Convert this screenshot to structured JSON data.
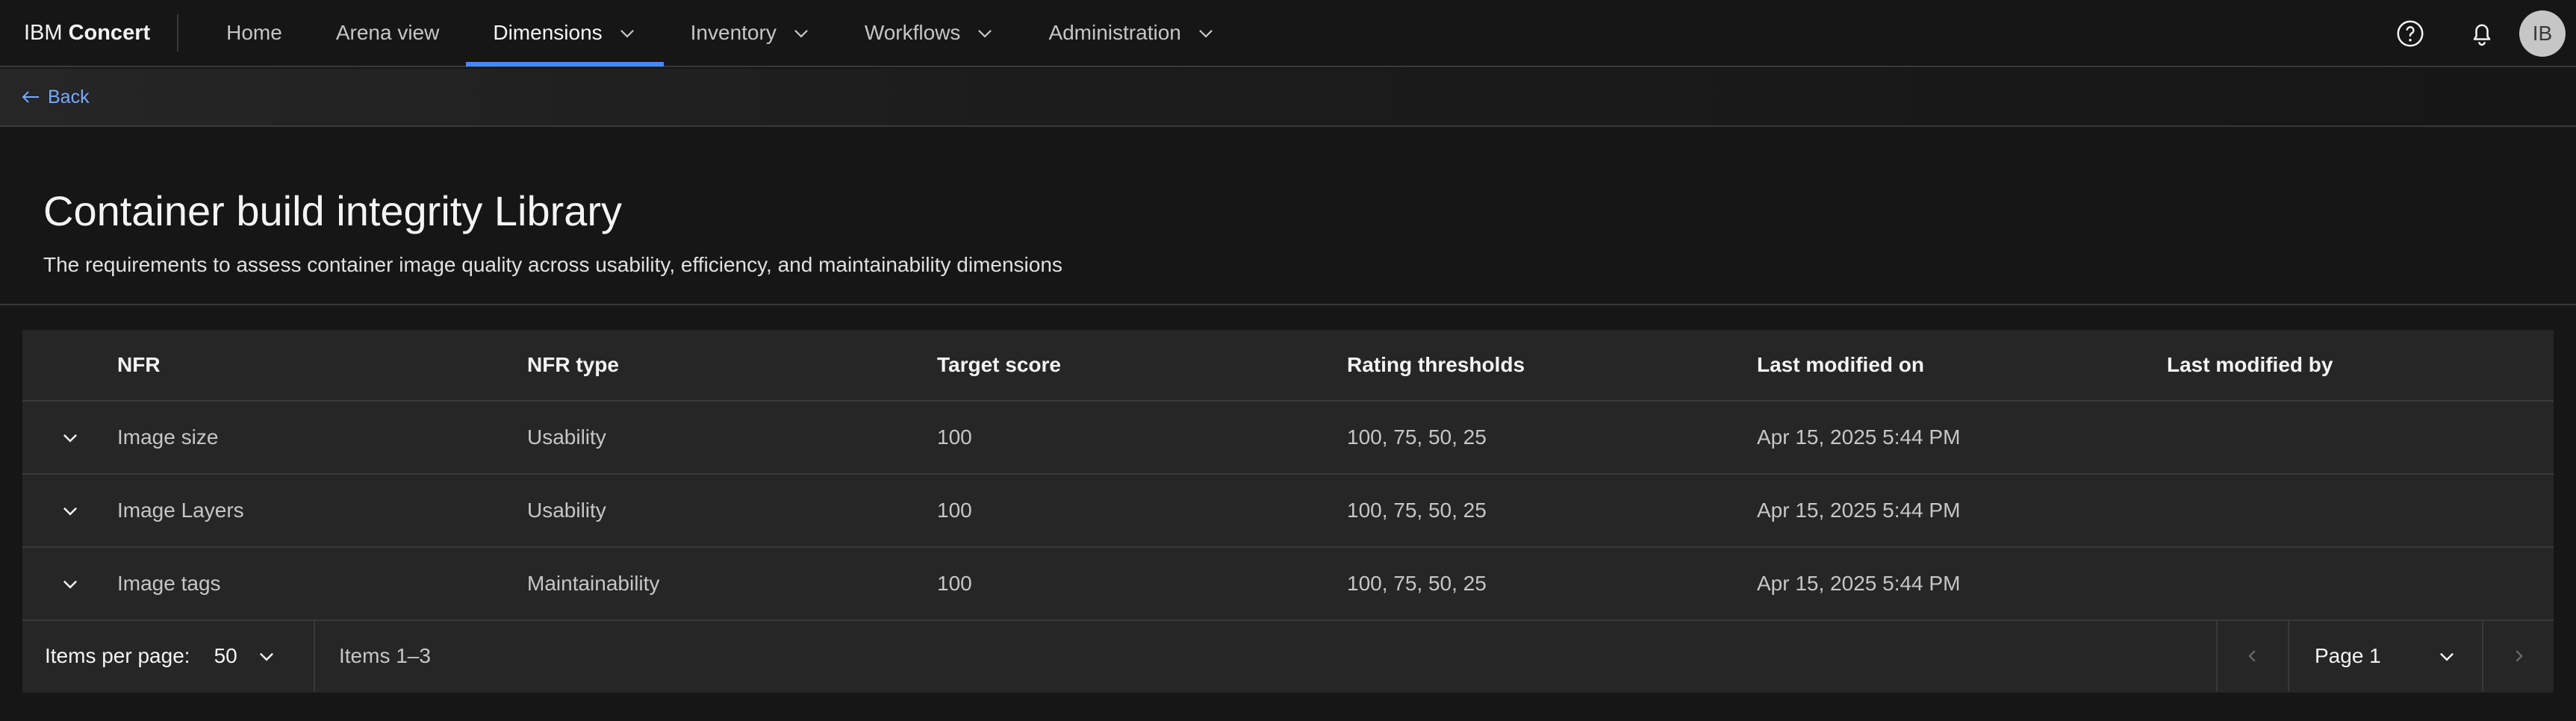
{
  "header": {
    "brand_prefix": "IBM",
    "brand_name": "Concert",
    "nav": [
      {
        "label": "Home"
      },
      {
        "label": "Arena view"
      },
      {
        "label": "Dimensions"
      },
      {
        "label": "Inventory"
      },
      {
        "label": "Workflows"
      },
      {
        "label": "Administration"
      }
    ],
    "avatar_initials": "IB"
  },
  "back": {
    "label": "Back"
  },
  "page": {
    "title": "Container build integrity Library",
    "description": "The requirements to assess container image quality across usability, efficiency, and maintainability dimensions"
  },
  "table": {
    "columns": [
      "NFR",
      "NFR type",
      "Target score",
      "Rating thresholds",
      "Last modified on",
      "Last modified by"
    ],
    "rows": [
      {
        "nfr": "Image size",
        "type": "Usability",
        "target": "100",
        "thresholds": "100, 75, 50, 25",
        "modified_on": "Apr 15, 2025 5:44 PM",
        "modified_by": ""
      },
      {
        "nfr": "Image Layers",
        "type": "Usability",
        "target": "100",
        "thresholds": "100, 75, 50, 25",
        "modified_on": "Apr 15, 2025 5:44 PM",
        "modified_by": ""
      },
      {
        "nfr": "Image tags",
        "type": "Maintainability",
        "target": "100",
        "thresholds": "100, 75, 50, 25",
        "modified_on": "Apr 15, 2025 5:44 PM",
        "modified_by": ""
      }
    ]
  },
  "pagination": {
    "items_per_page_label": "Items per page:",
    "items_per_page_value": "50",
    "items_range": "Items 1–3",
    "page_label": "Page 1"
  }
}
